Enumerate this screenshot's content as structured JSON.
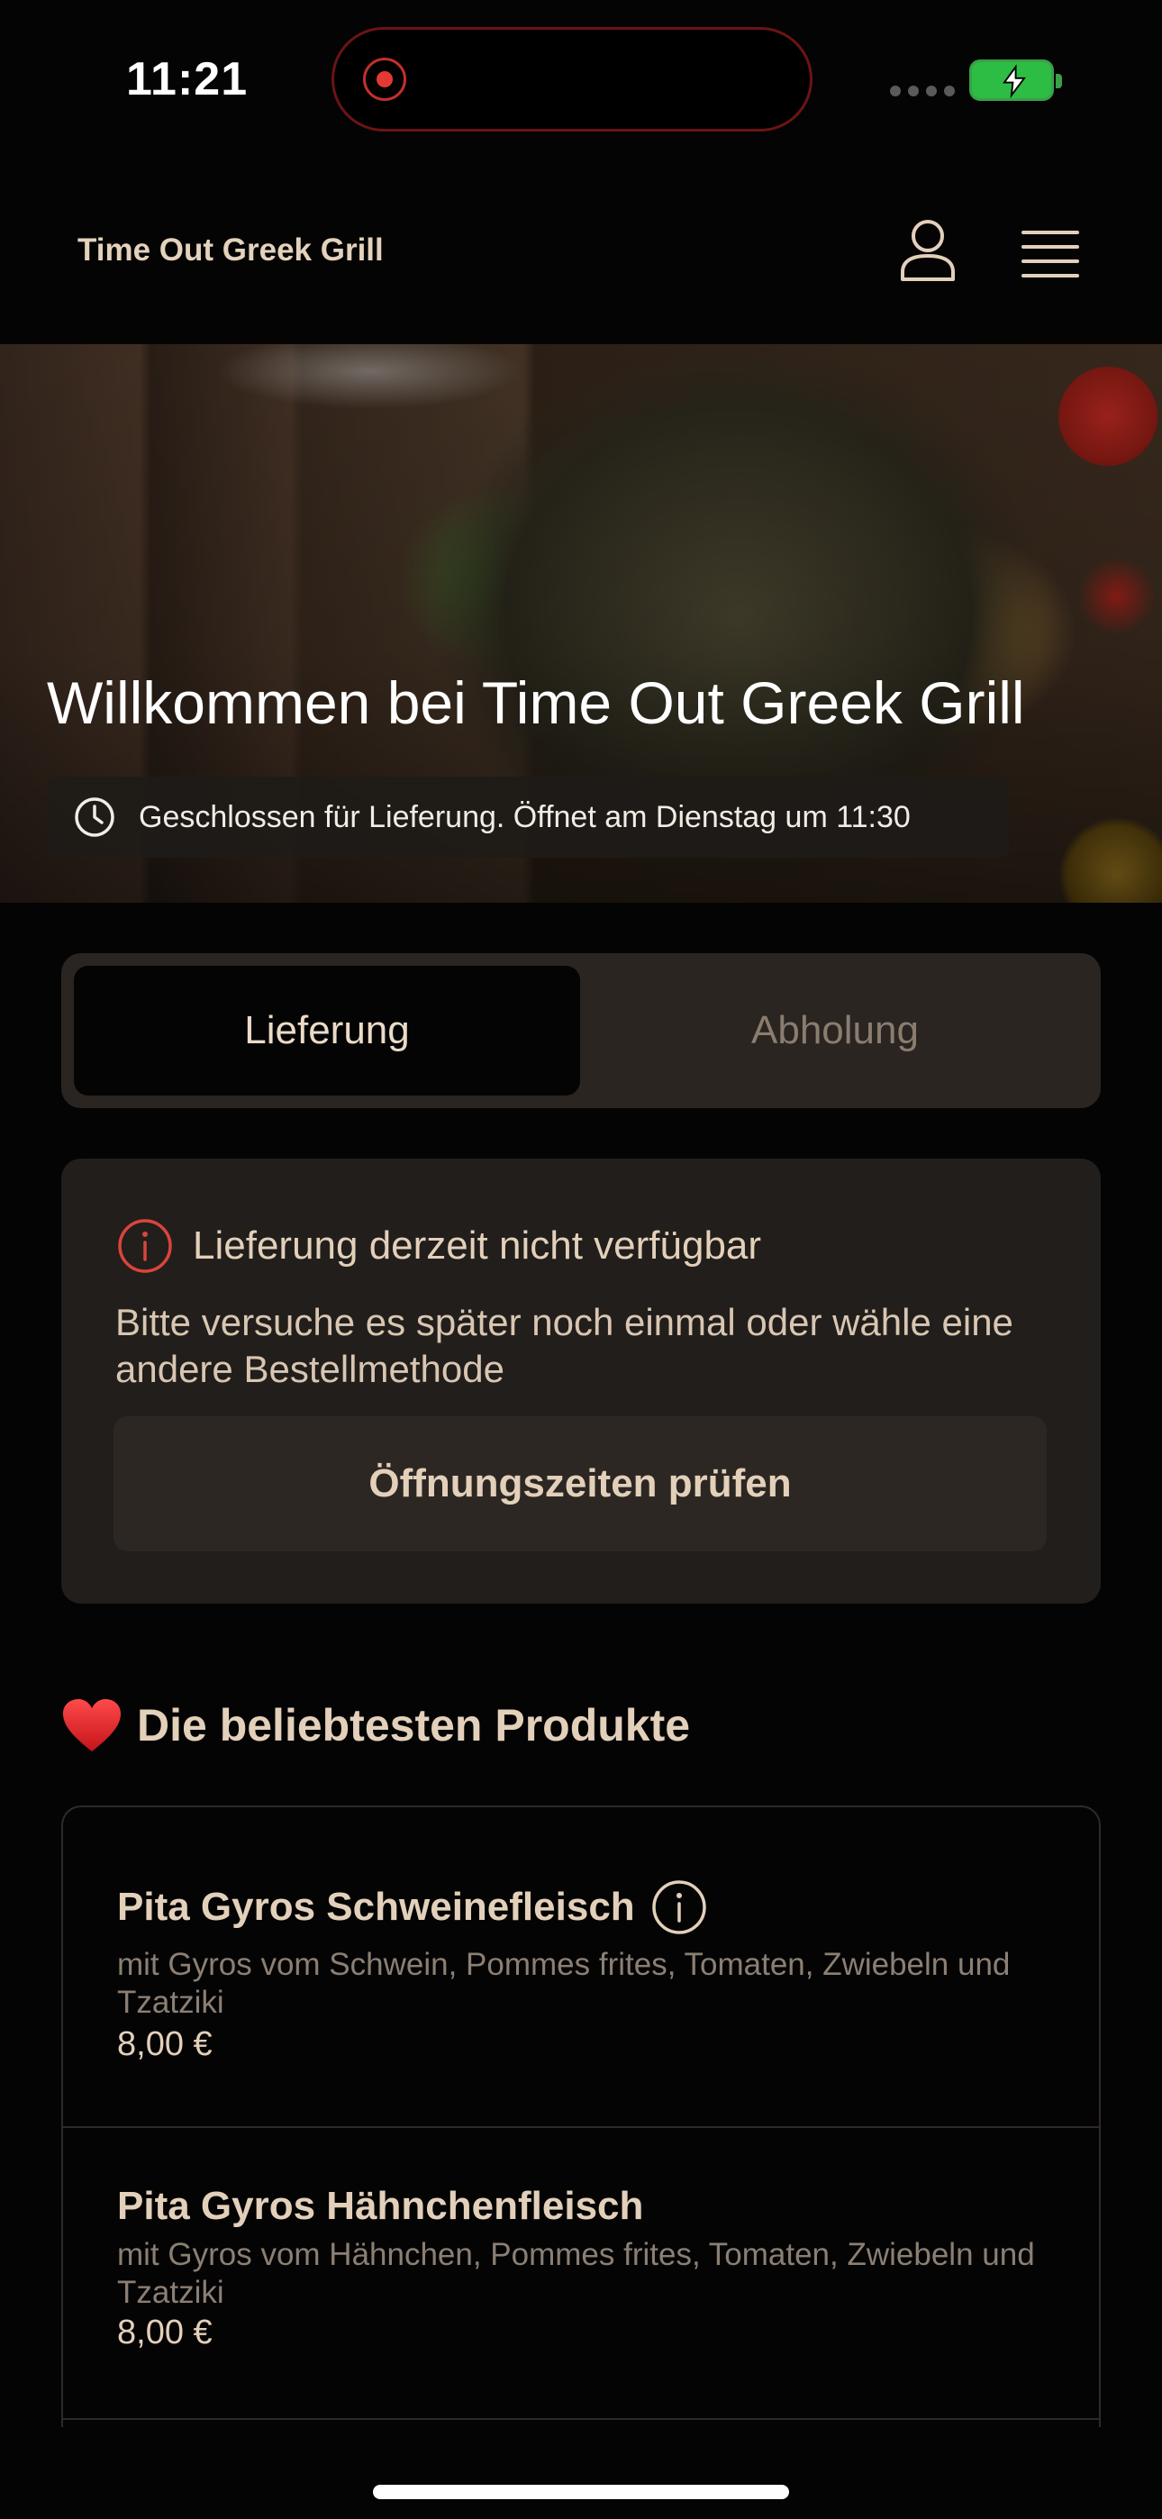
{
  "status_bar": {
    "time": "11:21"
  },
  "header": {
    "brand": "Time Out Greek Grill"
  },
  "hero": {
    "title": "Willkommen bei Time Out Greek Grill",
    "hours_notice": "Geschlossen für Lieferung. Öffnet am Dienstag um 11:30"
  },
  "order_mode": {
    "options": [
      "Lieferung",
      "Abholung"
    ],
    "selected": "Lieferung"
  },
  "alert": {
    "title": "Lieferung derzeit nicht verfügbar",
    "body": "Bitte versuche es später noch einmal oder wähle eine andere Bestellmethode",
    "button": "Öffnungszeiten prüfen"
  },
  "popular": {
    "title": "Die beliebtesten Produkte",
    "products": [
      {
        "name": "Pita Gyros Schweinefleisch",
        "description": "mit Gyros vom Schwein, Pommes frites, Tomaten, Zwiebeln und Tzatziki",
        "price": "8,00 €"
      },
      {
        "name": "Pita Gyros Hähnchenfleisch",
        "description": "mit Gyros vom Hähnchen, Pommes frites, Tomaten, Zwiebeln und Tzatziki",
        "price": "8,00 €"
      }
    ]
  },
  "colors": {
    "background": "#050404",
    "accent_text": "#e3d0ba",
    "alert_icon": "#d9453c",
    "battery": "#2dbd44"
  },
  "icons": [
    "record-icon",
    "signal-icon",
    "battery-icon",
    "user-icon",
    "menu-icon",
    "clock-icon",
    "info-icon",
    "heart-icon"
  ]
}
